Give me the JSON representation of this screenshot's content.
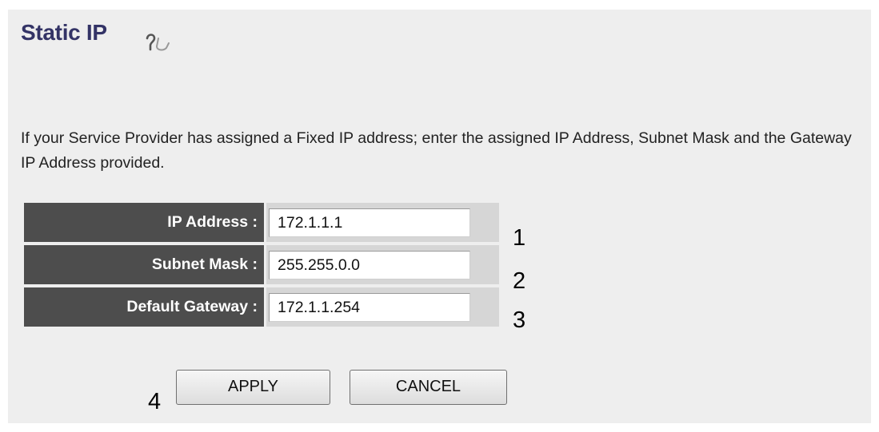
{
  "page": {
    "title": "Static IP",
    "description": "If your Service Provider has assigned a Fixed IP address; enter the assigned IP Address, Subnet Mask and the Gateway IP Address provided."
  },
  "form": {
    "fields": [
      {
        "label": "IP Address :",
        "value": "172.1.1.1",
        "callout": "1"
      },
      {
        "label": "Subnet Mask :",
        "value": "255.255.0.0",
        "callout": "2"
      },
      {
        "label": "Default Gateway :",
        "value": "172.1.1.254",
        "callout": "3"
      }
    ]
  },
  "buttons": {
    "apply_label": "APPLY",
    "cancel_label": "CANCEL",
    "callout": "4"
  },
  "icons": {
    "help": "help-icon"
  },
  "colors": {
    "title": "#333366",
    "label_bg": "#4d4d4d",
    "value_bg": "#d6d6d6",
    "panel_bg": "#eeeeee"
  }
}
